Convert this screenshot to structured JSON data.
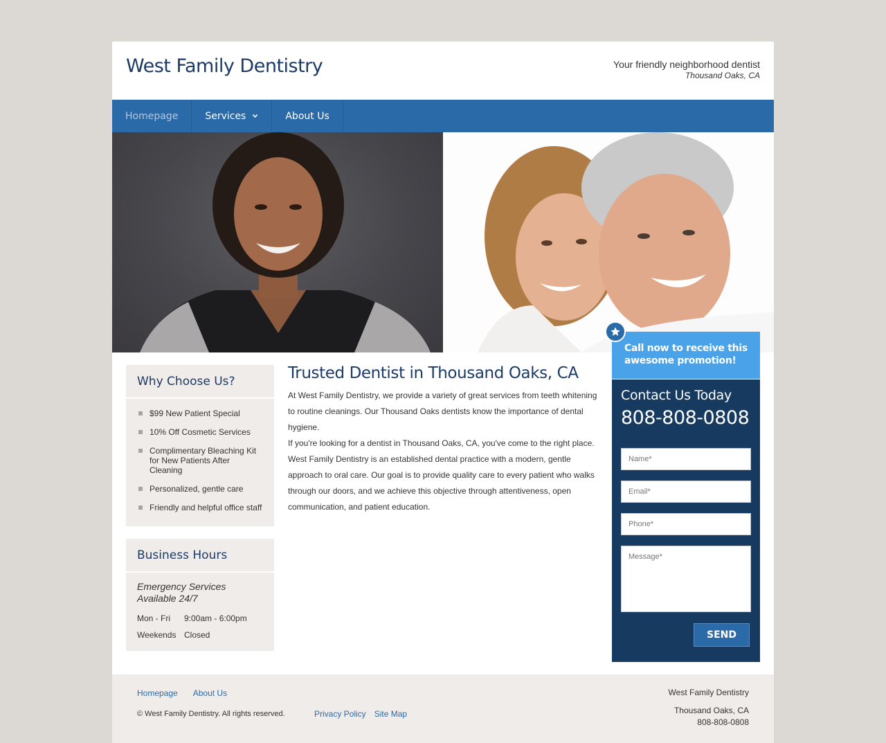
{
  "header": {
    "title": "West Family Dentistry",
    "tagline": "Your friendly neighborhood dentist",
    "location": "Thousand Oaks, CA"
  },
  "nav": {
    "items": [
      {
        "label": "Homepage",
        "active": true
      },
      {
        "label": "Services",
        "has_dropdown": true
      },
      {
        "label": "About Us"
      }
    ]
  },
  "why": {
    "title": "Why Choose Us?",
    "items": [
      "$99 New Patient Special",
      "10% Off Cosmetic Services",
      "Complimentary Bleaching Kit for New Patients After Cleaning",
      "Personalized, gentle care",
      "Friendly and helpful office staff"
    ]
  },
  "hours": {
    "title": "Business Hours",
    "emergency": "Emergency Services Available 24/7",
    "rows": [
      {
        "day": "Mon - Fri",
        "time": "9:00am - 6:00pm"
      },
      {
        "day": "Weekends",
        "time": "Closed"
      }
    ]
  },
  "main": {
    "title": "Trusted Dentist in Thousand Oaks, CA",
    "p1": "At West Family Dentistry, we provide a variety of great services from teeth whitening to routine cleanings. Our Thousand Oaks dentists know the importance of dental hygiene.",
    "p2": "If you're looking for a dentist in Thousand Oaks, CA, you've come to the right place. West Family Dentistry is an established dental practice with a modern, gentle approach to oral care. Our goal is to provide quality care to every patient who walks through our doors, and we achieve this objective through attentiveness, open communication, and patient education."
  },
  "promo": {
    "text": "Call now to receive this awesome promotion!"
  },
  "contact": {
    "title": "Contact Us Today",
    "phone": "808-808-0808",
    "name_placeholder": "Name*",
    "email_placeholder": "Email*",
    "phone_placeholder": "Phone*",
    "message_placeholder": "Message*",
    "send_label": "SEND"
  },
  "footer": {
    "links": [
      "Homepage",
      "About Us"
    ],
    "copyright": "© West Family Dentistry. All rights reserved.",
    "links2": [
      "Privacy Policy",
      "Site Map"
    ],
    "biz_name": "West Family Dentistry",
    "biz_city": "Thousand Oaks, CA",
    "biz_phone": "808-808-0808"
  },
  "colors": {
    "brand_dark": "#1c3a66",
    "nav_blue": "#2b6aa8",
    "promo_blue": "#4aa3e8",
    "contact_navy": "#173a60",
    "sidebar_bg": "#f0ecea"
  },
  "icons": {
    "nav_dropdown": "chevron-down-icon",
    "promo_badge": "star-icon",
    "list_bullet": "square-bullet-icon"
  }
}
